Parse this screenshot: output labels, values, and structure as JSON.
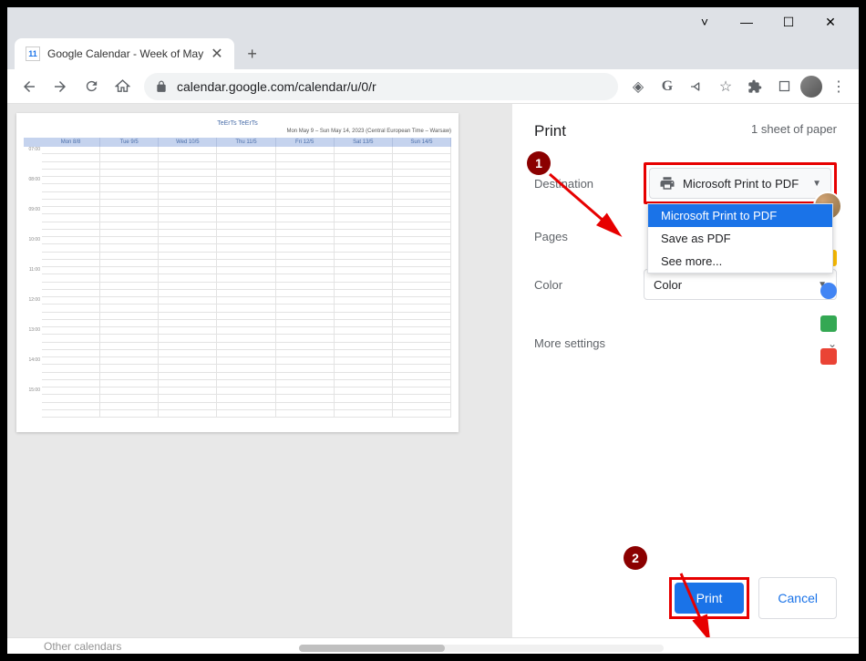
{
  "window": {
    "minimize": "—",
    "maximize": "☐",
    "close": "✕",
    "dropdown": "˅"
  },
  "tab": {
    "favicon": "11",
    "title": "Google Calendar - Week of May",
    "close": "✕"
  },
  "toolbar": {
    "url_lock": "🔒",
    "url": "calendar.google.com/calendar/u/0/r"
  },
  "print": {
    "title": "Print",
    "sheet_count": "1 sheet of paper",
    "destination_label": "Destination",
    "destination_value": "Microsoft Print to PDF",
    "destination_options": [
      "Microsoft Print to PDF",
      "Save as PDF",
      "See more..."
    ],
    "pages_label": "Pages",
    "color_label": "Color",
    "color_value": "Color",
    "more_settings": "More settings",
    "print_btn": "Print",
    "cancel_btn": "Cancel"
  },
  "calendar_preview": {
    "title": "TeErTs TeErTs",
    "subtitle": "Mon May 9 – Sun May 14, 2023 (Central European Time – Warsaw)",
    "days": [
      "Mon 8/8",
      "Tue 9/5",
      "Wed 10/5",
      "Thu 11/5",
      "Fri 12/5",
      "Sat 13/5",
      "Sun 14/5"
    ],
    "times": [
      "07:00",
      "08:00",
      "09:00",
      "10:00",
      "11:00",
      "12:00",
      "13:00",
      "14:00",
      "15:00"
    ]
  },
  "annotations": {
    "badge1": "1",
    "badge2": "2"
  },
  "bottom": {
    "other_calendars": "Other calendars"
  }
}
